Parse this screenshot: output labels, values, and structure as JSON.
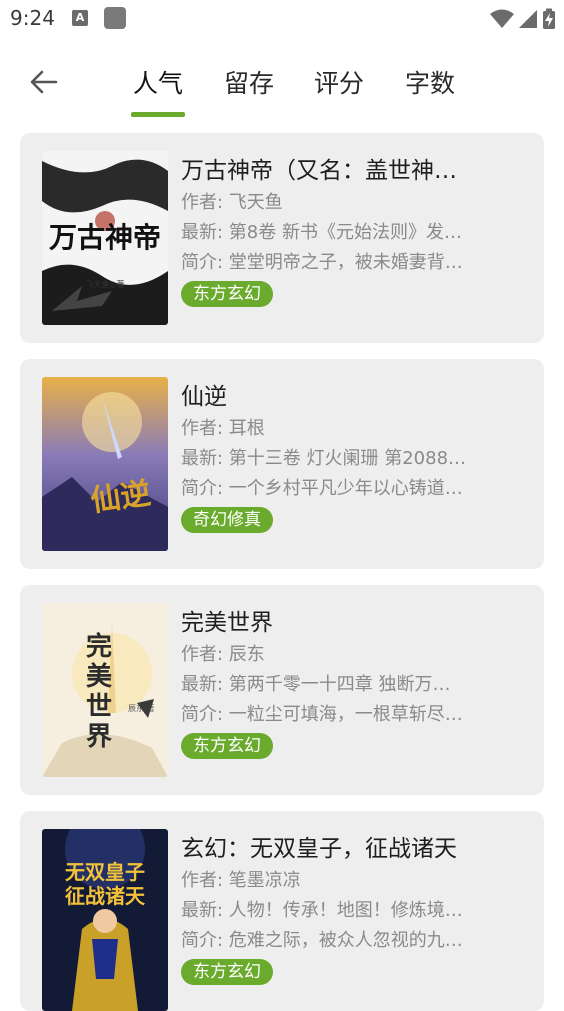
{
  "status_bar": {
    "time": "9:24",
    "icons": [
      "keyboard-a-icon",
      "app-square-icon",
      "wifi-icon",
      "signal-icon",
      "battery-charging-icon"
    ]
  },
  "tabs": [
    {
      "label": "人气",
      "active": true
    },
    {
      "label": "留存",
      "active": false
    },
    {
      "label": "评分",
      "active": false
    },
    {
      "label": "字数",
      "active": false
    }
  ],
  "accent_color": "#6aab2e",
  "books": [
    {
      "title": "万古神帝（又名：盖世神…",
      "author": "作者: 飞天鱼",
      "latest": "最新: 第8卷 新书《元始法则》发…",
      "intro": "简介: 堂堂明帝之子，被未婚妻背…",
      "tag": "东方玄幻",
      "cover_text": "万古神帝",
      "cover_sub": "飞天鱼◎著"
    },
    {
      "title": "仙逆",
      "author": "作者: 耳根",
      "latest": "最新: 第十三卷 灯火阑珊 第2088…",
      "intro": "简介: 一个乡村平凡少年以心铸道…",
      "tag": "奇幻修真",
      "cover_text": "仙逆",
      "cover_sub": ""
    },
    {
      "title": "完美世界",
      "author": "作者: 辰东",
      "latest": "最新: 第两千零一十四章 独断万…",
      "intro": "简介: 一粒尘可填海，一根草斩尽…",
      "tag": "东方玄幻",
      "cover_text": "完美世界",
      "cover_sub": "辰东 著"
    },
    {
      "title": "玄幻：无双皇子，征战诸天",
      "author": "作者: 笔墨凉凉",
      "latest": "最新: 人物！传承！地图！修炼境…",
      "intro": "简介: 危难之际，被众人忽视的九…",
      "tag": "东方玄幻",
      "cover_text": "无双皇子征战诸天",
      "cover_sub": ""
    }
  ]
}
